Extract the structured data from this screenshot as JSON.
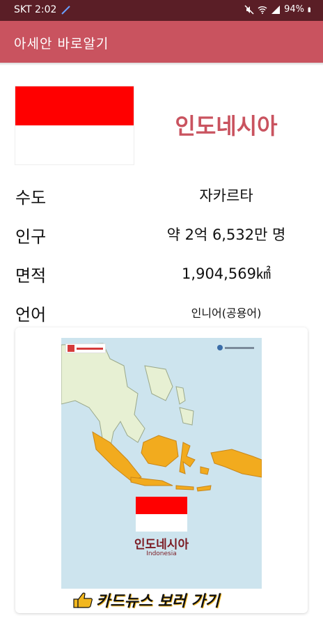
{
  "status_bar": {
    "carrier_time": "SKT 2:02",
    "battery": "94%"
  },
  "app_bar": {
    "title": "아세안 바로알기"
  },
  "country": {
    "name": "인도네시아",
    "flag_colors": [
      "#ff0000",
      "#ffffff"
    ]
  },
  "info": [
    {
      "label": "수도",
      "value": "자카르타"
    },
    {
      "label": "인구",
      "value": "약 2억 6,532만 명"
    },
    {
      "label": "면적",
      "value": "1,904,569㎢"
    },
    {
      "label": "언어",
      "value": "인니어(공용어)"
    }
  ],
  "card": {
    "map_country_ko": "인도네시아",
    "map_country_en": "Indonesia",
    "link_label": "카드뉴스 보러 가기"
  },
  "colors": {
    "status_bar": "#5a1e26",
    "app_bar": "#c9535f",
    "accent_text": "#c9535f",
    "map_sea": "#cde4ee",
    "map_land_highlight": "#f2ab1e",
    "map_land_other": "#e7f0d3"
  },
  "icons": [
    "pen-icon",
    "mute-icon",
    "signal-icon",
    "wifi-icon",
    "battery-icon",
    "thumbs-up-icon"
  ]
}
